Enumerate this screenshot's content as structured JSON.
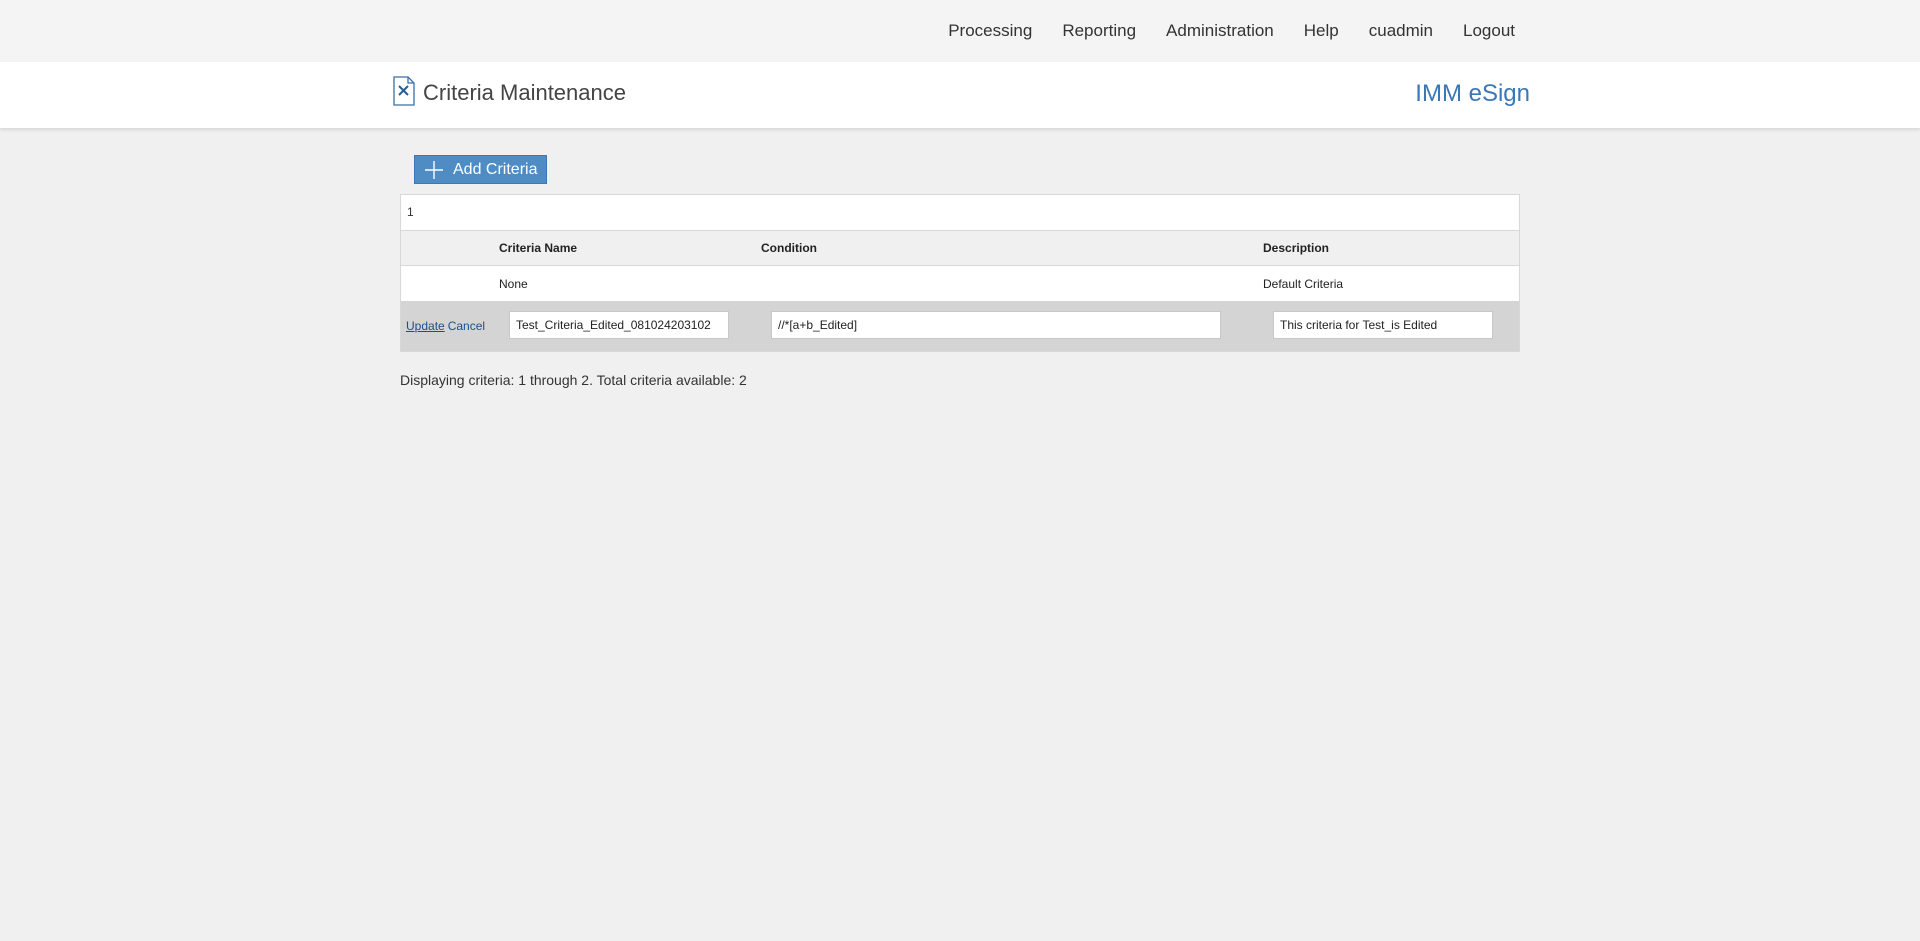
{
  "nav": {
    "items": [
      "Processing",
      "Reporting",
      "Administration",
      "Help",
      "cuadmin",
      "Logout"
    ]
  },
  "header": {
    "title": "Criteria Maintenance",
    "brand": "IMM eSign",
    "brand_color": "#3a78b5"
  },
  "toolbar": {
    "add_label": "Add Criteria",
    "add_icon": "plus-icon",
    "button_color": "#4f8cc4"
  },
  "grid": {
    "pager": "1",
    "columns": {
      "name": "Criteria Name",
      "condition": "Condition",
      "description": "Description"
    },
    "rows": [
      {
        "name": "None",
        "condition": "",
        "description": "Default Criteria"
      }
    ],
    "edit_row": {
      "update_label": "Update",
      "cancel_label": "Cancel",
      "name_value": "Test_Criteria_Edited_081024203102",
      "condition_value": "//*[a+b_Edited]",
      "description_value": "This criteria for Test_is Edited"
    }
  },
  "summary": "Displaying criteria: 1 through 2. Total criteria available: 2"
}
